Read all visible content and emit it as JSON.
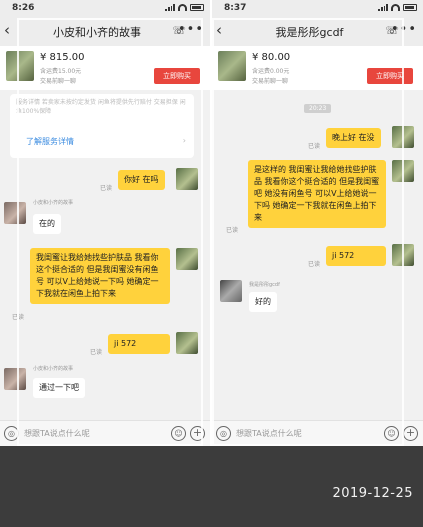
{
  "left": {
    "time": "8:26",
    "title": "小皮和小齐的故事",
    "product": {
      "price": "¥ 815.00",
      "shipping": "含运费15.00元",
      "deal": "交易前聊一聊",
      "buy": "立即购买"
    },
    "service_text": "服务详情 若卖家未按约定发货 闲鱼将提供先行赔付 交易担保 闲鱼100%保障",
    "service_link": "了解服务详情",
    "messages": [
      {
        "text": "你好 在吗",
        "read": "已读"
      },
      {
        "sender": "小皮和小齐的故事",
        "text": "在的"
      },
      {
        "text": "我闺蜜让我给她找些护肤品 我看你这个挺合适的 但是我闺蜜没有闲鱼号 可以V上给她说一下吗 她确定一下我就在闲鱼上拍下来",
        "read": "已读"
      },
      {
        "text": "ji              572",
        "read": "已读"
      },
      {
        "sender": "小皮和小齐的故事",
        "text": "通过一下吧"
      }
    ],
    "input_placeholder": "想跟TA说点什么呢"
  },
  "right": {
    "time": "8:37",
    "title": "我是彤彤gcdf",
    "product": {
      "price": "¥ 80.00",
      "shipping": "含运费0.00元",
      "deal": "交易前聊一聊",
      "buy": "立即购买"
    },
    "timestamp": "20:23",
    "messages": [
      {
        "text": "晚上好 在没",
        "read": "已读"
      },
      {
        "text": "是这样的 我闺蜜让我给她找些护肤品 我看你这个挺合适的 但是我闺蜜吧 她没有闲鱼号 可以V上给她说一下吗 她确定一下我就在闲鱼上拍下来",
        "read": "已读"
      },
      {
        "text": "ji             572",
        "read": "已读"
      },
      {
        "sender": "我是彤彤gcdf",
        "text": "好的"
      }
    ],
    "input_placeholder": "想跟TA说点什么呢"
  },
  "footer": {
    "date": "2019-12-25"
  },
  "icons": {
    "back": "‹",
    "call": "☏",
    "more": "•••",
    "voice": "◎",
    "emoji": "☺",
    "plus": "+"
  }
}
